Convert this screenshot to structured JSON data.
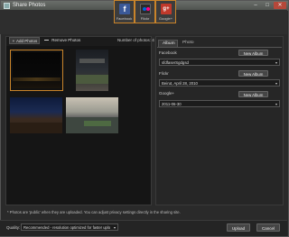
{
  "window": {
    "title": "Share Photos",
    "minimize_glyph": "–",
    "maximize_glyph": "□",
    "close_glyph": "✕"
  },
  "services": [
    {
      "name": "Facebook",
      "icon": "facebook-icon",
      "glyph": "f",
      "color": "#3b5998"
    },
    {
      "name": "Flickr",
      "icon": "flickr-icon",
      "glyph": "",
      "color": "#0063dc"
    },
    {
      "name": "Google+",
      "icon": "google-plus-icon",
      "glyph": "g+",
      "color": "#c0392b"
    }
  ],
  "toolbar": {
    "add_photos_label": "Add Photos",
    "add_glyph": "+",
    "remove_photos_label": "Remove Photos",
    "number_of_photos_label": "Number of photos: 4"
  },
  "photos": [
    {
      "label": "photo-1",
      "selected": true
    },
    {
      "label": "photo-2",
      "selected": false
    },
    {
      "label": "photo-3",
      "selected": false
    },
    {
      "label": "photo-4",
      "selected": false
    }
  ],
  "tabs": [
    "Album",
    "Photo"
  ],
  "albums": {
    "facebook": {
      "label": "Facebook",
      "new_album": "New Album",
      "selected": "sfdfaserSgdgsd"
    },
    "flickr": {
      "label": "Flickr",
      "new_album": "New Album",
      "selected": "Beirut, April 28, 2010"
    },
    "googleplus": {
      "label": "Google+",
      "new_album": "New Album",
      "selected": "2011-06-30"
    }
  },
  "caret_glyph": "▾",
  "notice": "* Photos are 'public' when they are uploaded. You can adjust privacy settings directly in the sharing site.",
  "footer": {
    "quality_label": "Quality:",
    "quality_value": "Recommended - resolution optimized for faster uplo",
    "upload_label": "Upload",
    "cancel_label": "Cancel"
  },
  "colors": {
    "accent": "#c9842a",
    "background": "#2a2a2a"
  }
}
